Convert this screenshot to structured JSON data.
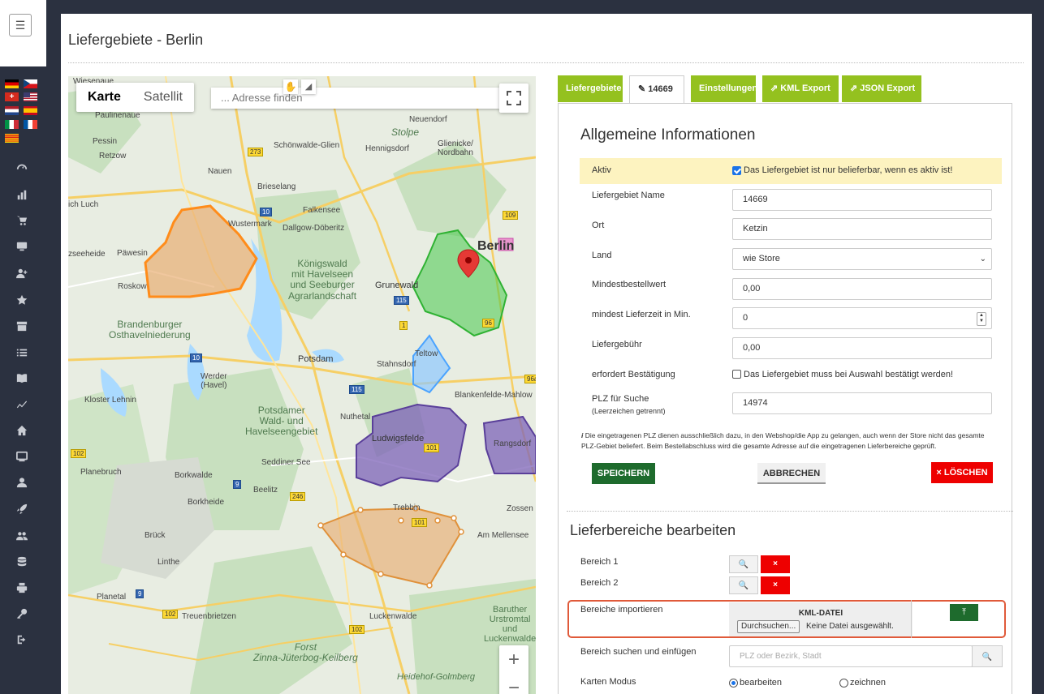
{
  "page": {
    "title": "Liefergebiete  - Berlin"
  },
  "sidebar": {
    "menu_icon": "hamburger-icon",
    "flags": [
      "flag-de",
      "flag-cz",
      "flag-ch",
      "flag-us",
      "flag-nl",
      "flag-es",
      "flag-it",
      "flag-fr",
      "flag-ca"
    ],
    "icons": [
      "dashboard-icon",
      "chart-icon",
      "cart-icon",
      "monitor-icon",
      "user-plus-icon",
      "star-icon",
      "archive-icon",
      "list-icon",
      "book-icon",
      "trend-icon",
      "home-icon",
      "display-icon",
      "user-icon",
      "rocket-icon",
      "users-icon",
      "database-icon",
      "printer-icon",
      "key-icon",
      "logout-icon"
    ]
  },
  "map": {
    "type_tabs": [
      "Karte",
      "Satellit"
    ],
    "search_placeholder": "... Adresse finden",
    "labels": {
      "wiesenaue": "Wiesenaue",
      "paulinenaue": "Paulinenaue",
      "pessin": "Pessin",
      "retzow": "Retzow",
      "nauen": "Nauen",
      "schoenwalde": "Schönwalde-Glien",
      "hennigsdorf": "Hennigsdorf",
      "neuendorf": "Neuendorf",
      "stolpe": "Stolpe",
      "glienicke": "Glienicke/\nNordbahn",
      "brieselang": "Brieselang",
      "falkensee": "Falkensee",
      "dallgow": "Dallgow-Döberitz",
      "wustermark": "Wustermark",
      "paewesin": "Päwesin",
      "seeheide": "zseeheide",
      "roskow": "Roskow",
      "berlin": "Berlin",
      "koenigswald": "Königswald\nmit Havelseen\nund Seeburger\nAgrarlandschaft",
      "grunewald": "Grunewald",
      "brandenburger": "Brandenburger\nOsthavelniederung",
      "potsdam": "Potsdam",
      "teltow": "Teltow",
      "stahnsdorf": "Stahnsdorf",
      "werder": "Werder\n(Havel)",
      "kloster": "Kloster Lehnin",
      "blankenfelde": "Blankenfelde-Mahlow",
      "potsdamer_wald": "Potsdamer\nWald- und\nHavelseengebiet",
      "nuthetal": "Nuthetal",
      "ludwigsfelde": "Ludwigsfelde",
      "rangsdorf": "Rangsdorf",
      "seddiner": "Seddiner See",
      "planebruch": "Planebruch",
      "borkwalde": "Borkwalde",
      "beelitz": "Beelitz",
      "borkheide": "Borkheide",
      "trebbin": "Trebbin",
      "zossen": "Zossen",
      "am_mellensee": "Am Mellensee",
      "brueck": "Brück",
      "linthe": "Linthe",
      "planetal": "Planetal",
      "treuenbrietzen": "Treuenbrietzen",
      "luckenwalde": "Luckenwalde",
      "baruther": "Baruther\nUrstromtal\nund\nLuckenwalde",
      "forst": "Forst\nZinna-Jüterbog-Keilberg",
      "heidehof": "Heidehof-Golmberg",
      "skriez": "ich Luch"
    },
    "shields": [
      "273",
      "109",
      "10",
      "115",
      "96",
      "1",
      "10",
      "115",
      "101",
      "246",
      "9",
      "96a",
      "102",
      "9",
      "102",
      "102",
      "101"
    ]
  },
  "tabs": {
    "liefergebiete": "Liefergebiete",
    "edit_id": "14669",
    "einstellungen": "Einstellungen",
    "kml_export": "KML Export",
    "json_export": "JSON Export"
  },
  "general": {
    "heading": "Allgemeine Informationen",
    "aktiv_label": "Aktiv",
    "aktiv_text": "Das Liefergebiet ist nur belieferbar, wenn es aktiv ist!",
    "aktiv_checked": true,
    "name_label": "Liefergebiet Name",
    "name_value": "14669",
    "ort_label": "Ort",
    "ort_value": "Ketzin",
    "land_label": "Land",
    "land_value": "wie Store",
    "mbw_label": "Mindestbestellwert",
    "mbw_value": "0,00",
    "lieferzeit_label": "mindest Lieferzeit in Min.",
    "lieferzeit_value": "0",
    "gebuehr_label": "Liefergebühr",
    "gebuehr_value": "0,00",
    "bestaetigung_label": "erfordert Bestätigung",
    "bestaetigung_text": "Das Liefergebiet muss bei Auswahl bestätigt werden!",
    "plz_label": "PLZ für Suche",
    "plz_sublabel": "(Leerzeichen getrennt)",
    "plz_value": "14974",
    "note": "Die eingetragenen PLZ dienen ausschließlich dazu, in den Webshop/die App zu gelangen, auch wenn der Store nicht das gesamte PLZ-Gebiet beliefert. Beim Bestellabschluss wird die gesamte Adresse auf die eingetragenen Lieferbereiche geprüft.",
    "save": "SPEICHERN",
    "cancel": "ABBRECHEN",
    "delete": "LÖSCHEN"
  },
  "areas": {
    "heading": "Lieferbereiche bearbeiten",
    "bereich1": "Bereich 1",
    "bereich2": "Bereich 2",
    "import_label": "Bereiche importieren",
    "kml_title": "KML-DATEI",
    "browse": "Durchsuchen...",
    "no_file": "Keine Datei ausgewählt.",
    "search_label": "Bereich suchen und einfügen",
    "search_placeholder": "PLZ oder Bezirk, Stadt",
    "mode_label": "Karten Modus",
    "mode_edit": "bearbeiten",
    "mode_draw": "zeichnen",
    "mode_selected": "bearbeiten"
  },
  "colors": {
    "accent_green": "#94c11f",
    "save_green": "#1e6b2d",
    "delete_red": "#e00000",
    "highlight_orange": "#e05a3a"
  }
}
